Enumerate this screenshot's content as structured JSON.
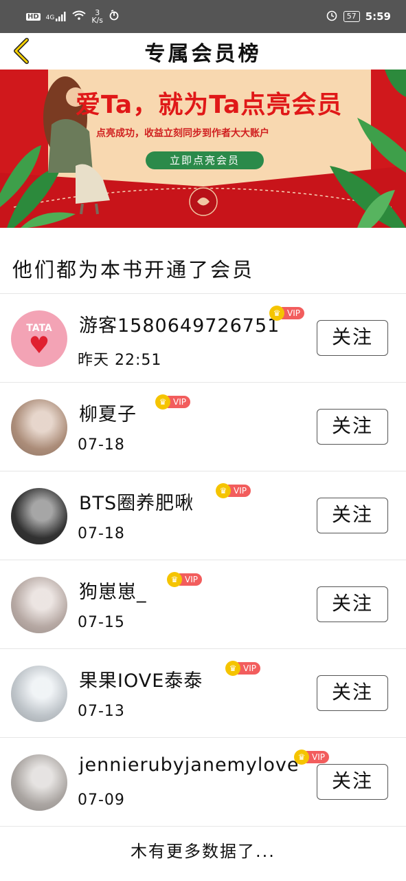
{
  "status_bar": {
    "hd": "HD",
    "signal": "4G",
    "speed_value": "3",
    "speed_unit": "K/s",
    "battery": "57",
    "time": "5:59"
  },
  "nav": {
    "title": "专属会员榜",
    "back_icon": "chevron-left-icon"
  },
  "banner": {
    "title": "爱Ta，就为Ta点亮会员",
    "subtitle": "点亮成功，收益立刻同步到作者大大账户",
    "button": "立即点亮会员"
  },
  "section": {
    "title": "他们都为本书开通了会员"
  },
  "members": [
    {
      "name": "游客1580649726751",
      "date": "昨天 22:51",
      "vip": "VIP",
      "follow": "关注",
      "avatar_color": "#f3a3b5",
      "avatar_text": "TATA"
    },
    {
      "name": "柳夏子",
      "date": "07-18",
      "vip": "VIP",
      "follow": "关注",
      "avatar_color": "#c9a58e",
      "avatar_text": ""
    },
    {
      "name": "BTS圈养肥啾",
      "date": "07-18",
      "vip": "VIP",
      "follow": "关注",
      "avatar_color": "#3a3a3a",
      "avatar_text": ""
    },
    {
      "name": "狗崽崽_",
      "date": "07-15",
      "vip": "VIP",
      "follow": "关注",
      "avatar_color": "#d6c6c0",
      "avatar_text": ""
    },
    {
      "name": "果果IOVE泰泰",
      "date": "07-13",
      "vip": "VIP",
      "follow": "关注",
      "avatar_color": "#dfe6ec",
      "avatar_text": ""
    },
    {
      "name": "jennierubyjanemylove",
      "date": "07-09",
      "vip": "VIP",
      "follow": "关注",
      "avatar_color": "#c8c2be",
      "avatar_text": ""
    }
  ],
  "footer": {
    "text": "木有更多数据了..."
  },
  "colors": {
    "vip_tag": "#f25d5d",
    "crown": "#f5c400",
    "banner_red": "#d0181c",
    "banner_button": "#2b8a4a"
  }
}
